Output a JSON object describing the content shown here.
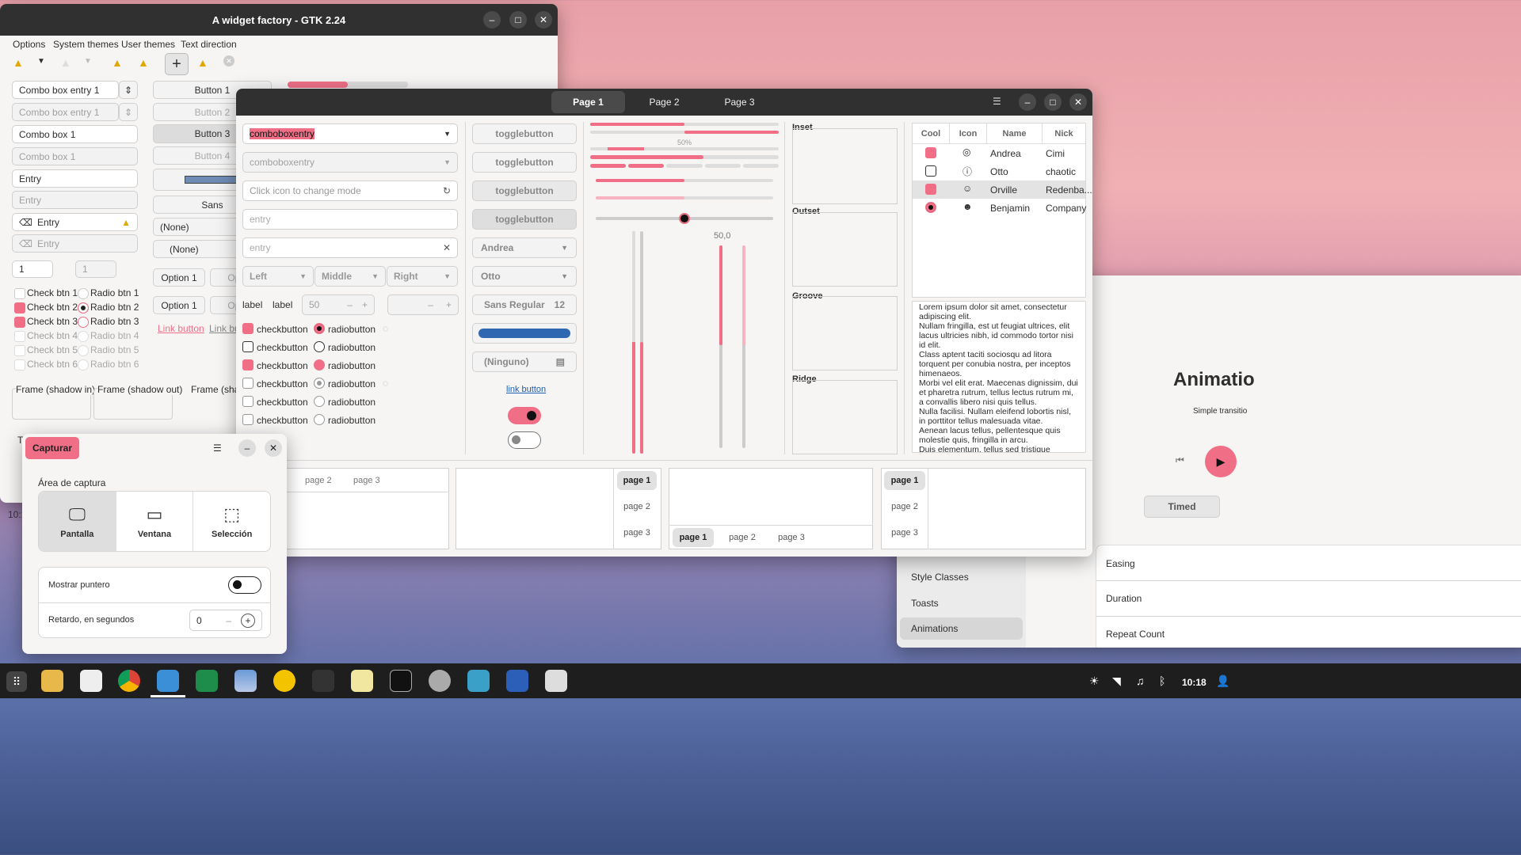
{
  "factory": {
    "title": "A widget factory - GTK 2.24",
    "menu": [
      "Options",
      "System themes",
      "User themes",
      "Text direction"
    ],
    "combo_entry": "Combo box entry 1",
    "combo_entry_dis": "Combo box entry 1",
    "combo": "Combo box 1",
    "combo_dis": "Combo box 1",
    "entry": "Entry",
    "entry_ph": "Entry",
    "icon_entry": "Entry",
    "icon_entry_dis": "Entry",
    "spin": "1",
    "spin_dis": "1",
    "checks": [
      "Check btn 1",
      "Check btn 2",
      "Check btn 3",
      "Check btn 4",
      "Check btn 5",
      "Check btn 6"
    ],
    "radios": [
      "Radio btn 1",
      "Radio btn 2",
      "Radio btn 3",
      "Radio btn 4",
      "Radio btn 5",
      "Radio btn 6"
    ],
    "buttons": [
      "Button 1",
      "Button 2",
      "Button 3",
      "Button 4"
    ],
    "font": "Sans",
    "none1": "(None)",
    "none2": "(None)",
    "option1": "Option 1",
    "option2": "Option 1",
    "option_trunc": "Option",
    "link": "Link button",
    "link2": "Link butt",
    "frame_in": "Frame (shadow in)",
    "frame_out": "Frame (shadow out)",
    "frame_trunc": "Frame (shad",
    "time": "10:1",
    "tab_t": "T"
  },
  "gtk4": {
    "tabs": [
      "Page 1",
      "Page 2",
      "Page 3"
    ],
    "cbe": "comboboxentry",
    "cbe2": "comboboxentry",
    "mode_ph": "Click icon to change mode",
    "entry_ph": "entry",
    "entry2_ph": "entry",
    "seg": [
      "Left",
      "Middle",
      "Right"
    ],
    "label1": "label",
    "label2": "label",
    "spin": "50",
    "checkbuttons": [
      "checkbutton",
      "checkbutton",
      "checkbutton",
      "checkbutton",
      "checkbutton",
      "checkbutton"
    ],
    "radiobuttons": [
      "radiobutton",
      "radiobutton",
      "radiobutton",
      "radiobutton",
      "radiobutton",
      "radiobutton"
    ],
    "toggles": [
      "togglebutton",
      "togglebutton",
      "togglebutton",
      "togglebutton"
    ],
    "dd1": "Andrea",
    "dd2": "Otto",
    "font": "Sans Regular",
    "font_size": "12",
    "file": "(Ninguno)",
    "link": "link button",
    "pct": "50%",
    "scale_val": "50,0",
    "progress": 0.5,
    "frames": [
      "Inset",
      "Outset",
      "Groove",
      "Ridge"
    ],
    "cols": [
      "Cool",
      "Icon",
      "Name",
      "Nick"
    ],
    "rows": [
      {
        "name": "Andrea",
        "nick": "Cimi"
      },
      {
        "name": "Otto",
        "nick": "chaotic"
      },
      {
        "name": "Orville",
        "nick": "Redenba..."
      },
      {
        "name": "Benjamin",
        "nick": "Company"
      }
    ],
    "text": [
      "Lorem ipsum dolor sit amet, consectetur adipiscing elit.",
      "Nullam fringilla, est ut feugiat ultrices, elit lacus ultricies nibh, id commodo tortor nisi id elit.",
      "Class aptent taciti sociosqu ad litora torquent per conubia nostra, per inceptos himenaeos.",
      "Morbi vel elit erat. Maecenas dignissim, dui et pharetra rutrum, tellus lectus rutrum mi, a convallis libero nisi quis tellus.",
      "Nulla facilisi. Nullam eleifend lobortis nisl, in porttitor tellus malesuada vitae.",
      "Aenean lacus tellus, pellentesque quis molestie quis, fringilla in arcu.",
      "Duis elementum, tellus sed tristique semper, metus metus accumsan augue, et porttitor augue orci a libero."
    ],
    "nb": {
      "a": [
        "page 2",
        "page 3"
      ],
      "b": [
        "page 1",
        "page 2",
        "page 3"
      ],
      "c": [
        "page 1",
        "page 2",
        "page 3"
      ],
      "d": [
        "page 1",
        "page 2",
        "page 3"
      ]
    }
  },
  "capture": {
    "title": "Capturar",
    "area": "Área de captura",
    "modes": [
      "Pantalla",
      "Ventana",
      "Selección"
    ],
    "pointer": "Mostrar puntero",
    "delay": "Retardo, en segundos",
    "delay_val": "0"
  },
  "demo": {
    "title": "Animatio",
    "sub": "Simple transitio",
    "timed": "Timed",
    "side": [
      "Style Classes",
      "Toasts",
      "Animations"
    ],
    "props": [
      "Easing",
      "Duration",
      "Repeat Count"
    ]
  },
  "clock": "10:18",
  "accent": "#f06f86"
}
